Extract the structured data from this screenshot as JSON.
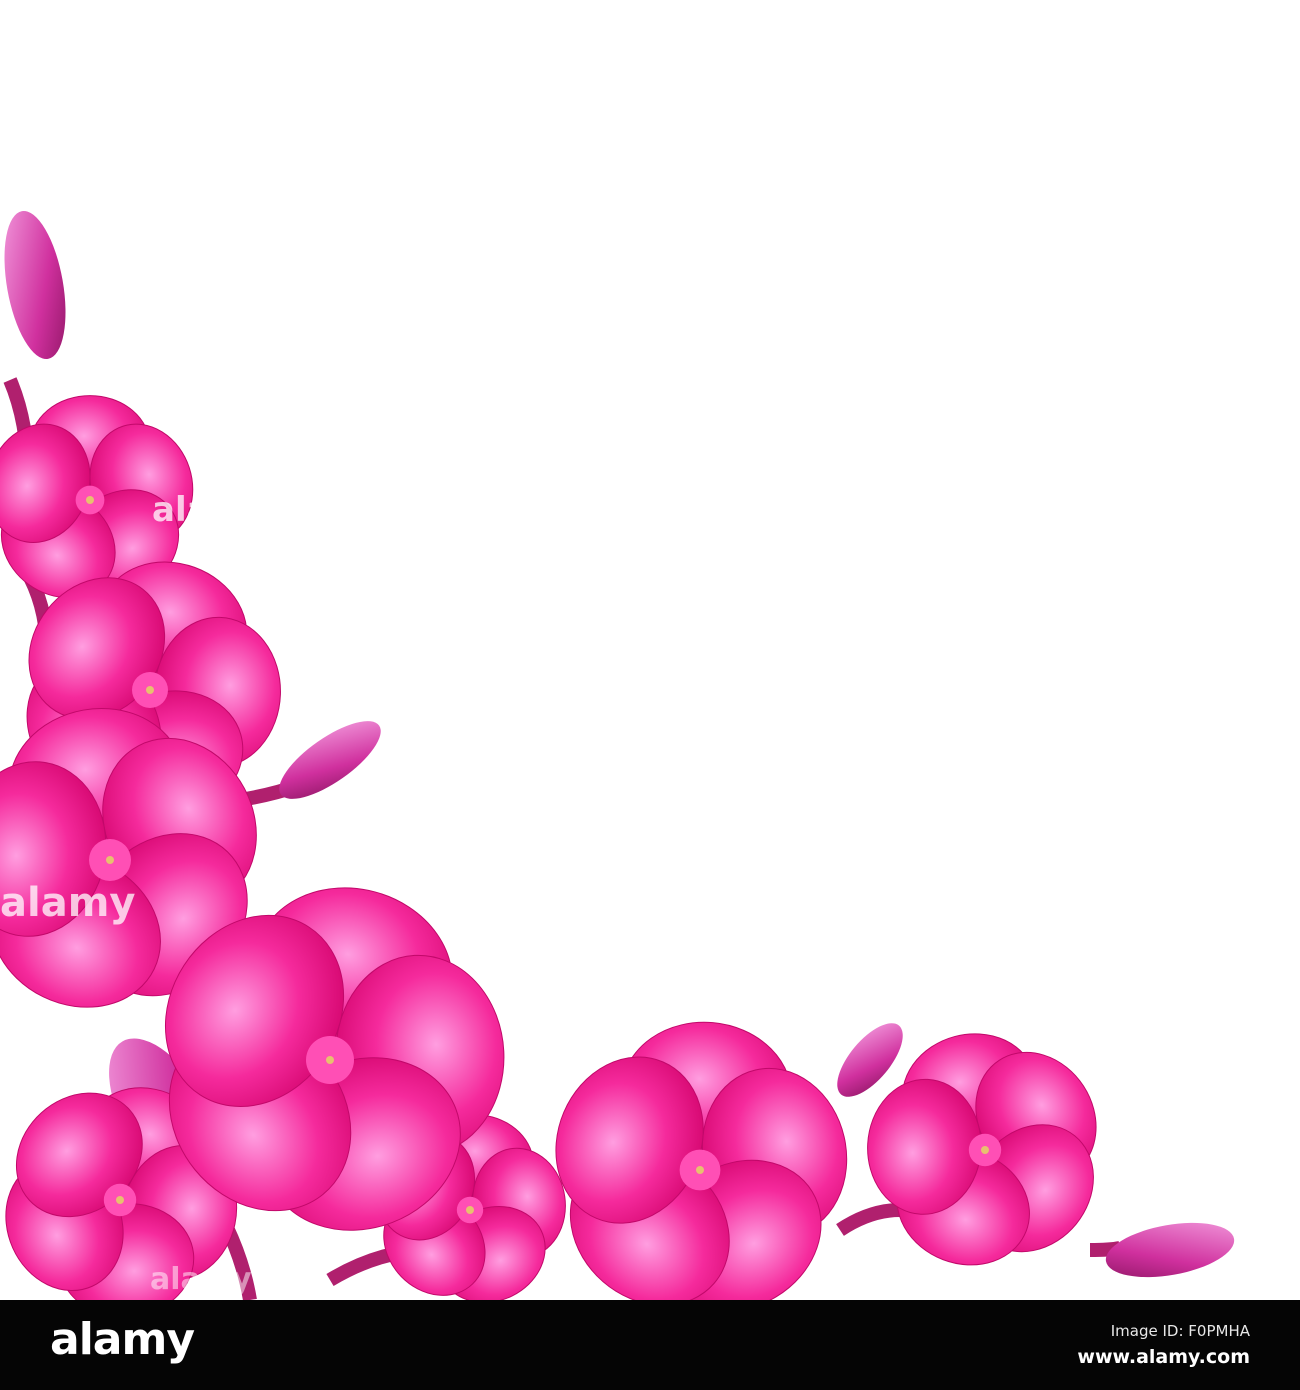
{
  "watermark": {
    "text": "alamy"
  },
  "footer": {
    "logo": "alamy",
    "image_id": "Image ID: F0PMHA",
    "website": "www.alamy.com"
  },
  "colors": {
    "petal_dark": "#e8097a",
    "petal_light": "#ff8fd8",
    "bar": "#050505"
  }
}
